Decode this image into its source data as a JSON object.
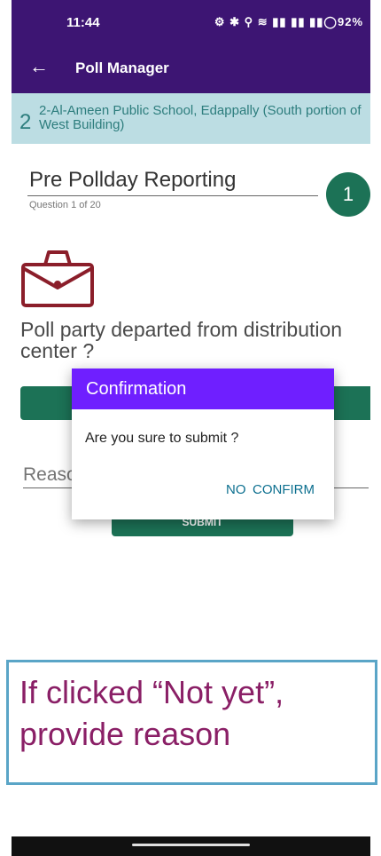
{
  "status_bar": {
    "time": "11:44",
    "icons": "⚙ ✱ ⚲ ≋ ▮▮ ▮▮ ▮▮◯92%",
    "battery": "92%"
  },
  "app_bar": {
    "back_icon": "←",
    "title": "Poll Manager"
  },
  "station": {
    "number": "2",
    "name": "2-Al-Ameen Public School, Edappally (South portion of West Building)"
  },
  "section": {
    "title": "Pre Pollday Reporting",
    "question_count": "Question 1 of 20",
    "step": "1"
  },
  "question": {
    "text": "Poll party departed from distribution center ?",
    "icon": "briefcase-icon"
  },
  "reason": {
    "placeholder": "Reason"
  },
  "submit": {
    "label": "SUBMIT"
  },
  "dialog": {
    "title": "Confirmation",
    "message": "Are you sure to submit ?",
    "no_label": "NO",
    "confirm_label": "CONFIRM"
  },
  "callout": {
    "text": "If clicked “Not yet”, provide reason"
  },
  "colors": {
    "app_bar": "#3d1573",
    "dialog_header": "#6f1fff",
    "banner_bg": "#bcdde3",
    "banner_text": "#2d7d7d",
    "green": "#1c7256",
    "briefcase": "#8b1e2a",
    "callout_border": "#5aa5c7",
    "callout_text": "#8a1f66"
  }
}
